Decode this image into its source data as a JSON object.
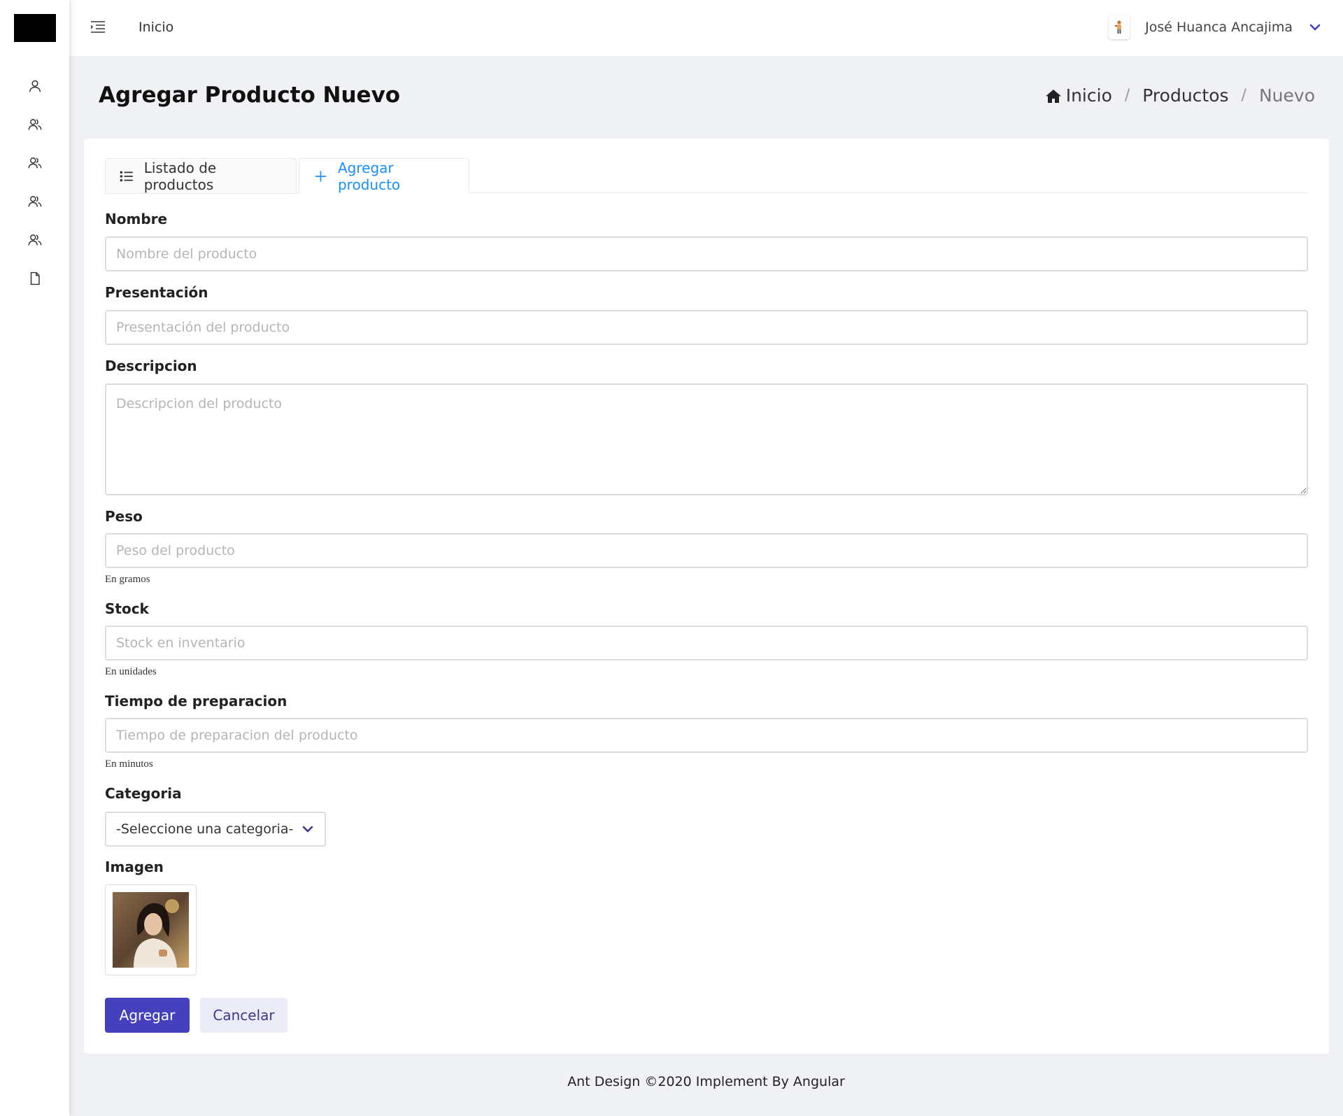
{
  "colors": {
    "accent": "#1890ff",
    "primary_button": "#4540bd",
    "background": "#f0f1f5"
  },
  "sidebar": {
    "logo": "logo",
    "items": [
      {
        "icon": "user-icon"
      },
      {
        "icon": "users-icon"
      },
      {
        "icon": "users-icon"
      },
      {
        "icon": "users-icon"
      },
      {
        "icon": "users-icon"
      },
      {
        "icon": "file-icon"
      }
    ]
  },
  "header": {
    "menu_icon": "menu-fold-icon",
    "home_label": "Inicio",
    "user_name": "José Huanca Ancajima"
  },
  "page": {
    "title": "Agregar Producto Nuevo",
    "breadcrumb": {
      "home": "Inicio",
      "section": "Productos",
      "current": "Nuevo",
      "separator": "/"
    }
  },
  "tabs": [
    {
      "label": "Listado de productos",
      "icon": "list-icon",
      "active": false
    },
    {
      "label": "Agregar producto",
      "icon": "plus-icon",
      "active": true
    }
  ],
  "form": {
    "nombre": {
      "label": "Nombre",
      "placeholder": "Nombre del producto",
      "value": ""
    },
    "presentacion": {
      "label": "Presentación",
      "placeholder": "Presentación del producto",
      "value": ""
    },
    "descripcion": {
      "label": "Descripcion",
      "placeholder": "Descripcion del producto",
      "value": ""
    },
    "peso": {
      "label": "Peso",
      "placeholder": "Peso del producto",
      "value": "",
      "help": "En gramos"
    },
    "stock": {
      "label": "Stock",
      "placeholder": "Stock en inventario",
      "value": "",
      "help": "En unidades"
    },
    "tiempo": {
      "label": "Tiempo de preparacion",
      "placeholder": "Tiempo de preparacion del producto",
      "value": "",
      "help": "En minutos"
    },
    "categoria": {
      "label": "Categoria",
      "selected": "-Seleccione una categoria-"
    },
    "imagen": {
      "label": "Imagen"
    }
  },
  "buttons": {
    "submit": "Agregar",
    "cancel": "Cancelar"
  },
  "footer": {
    "text": "Ant Design ©2020 Implement By Angular"
  }
}
